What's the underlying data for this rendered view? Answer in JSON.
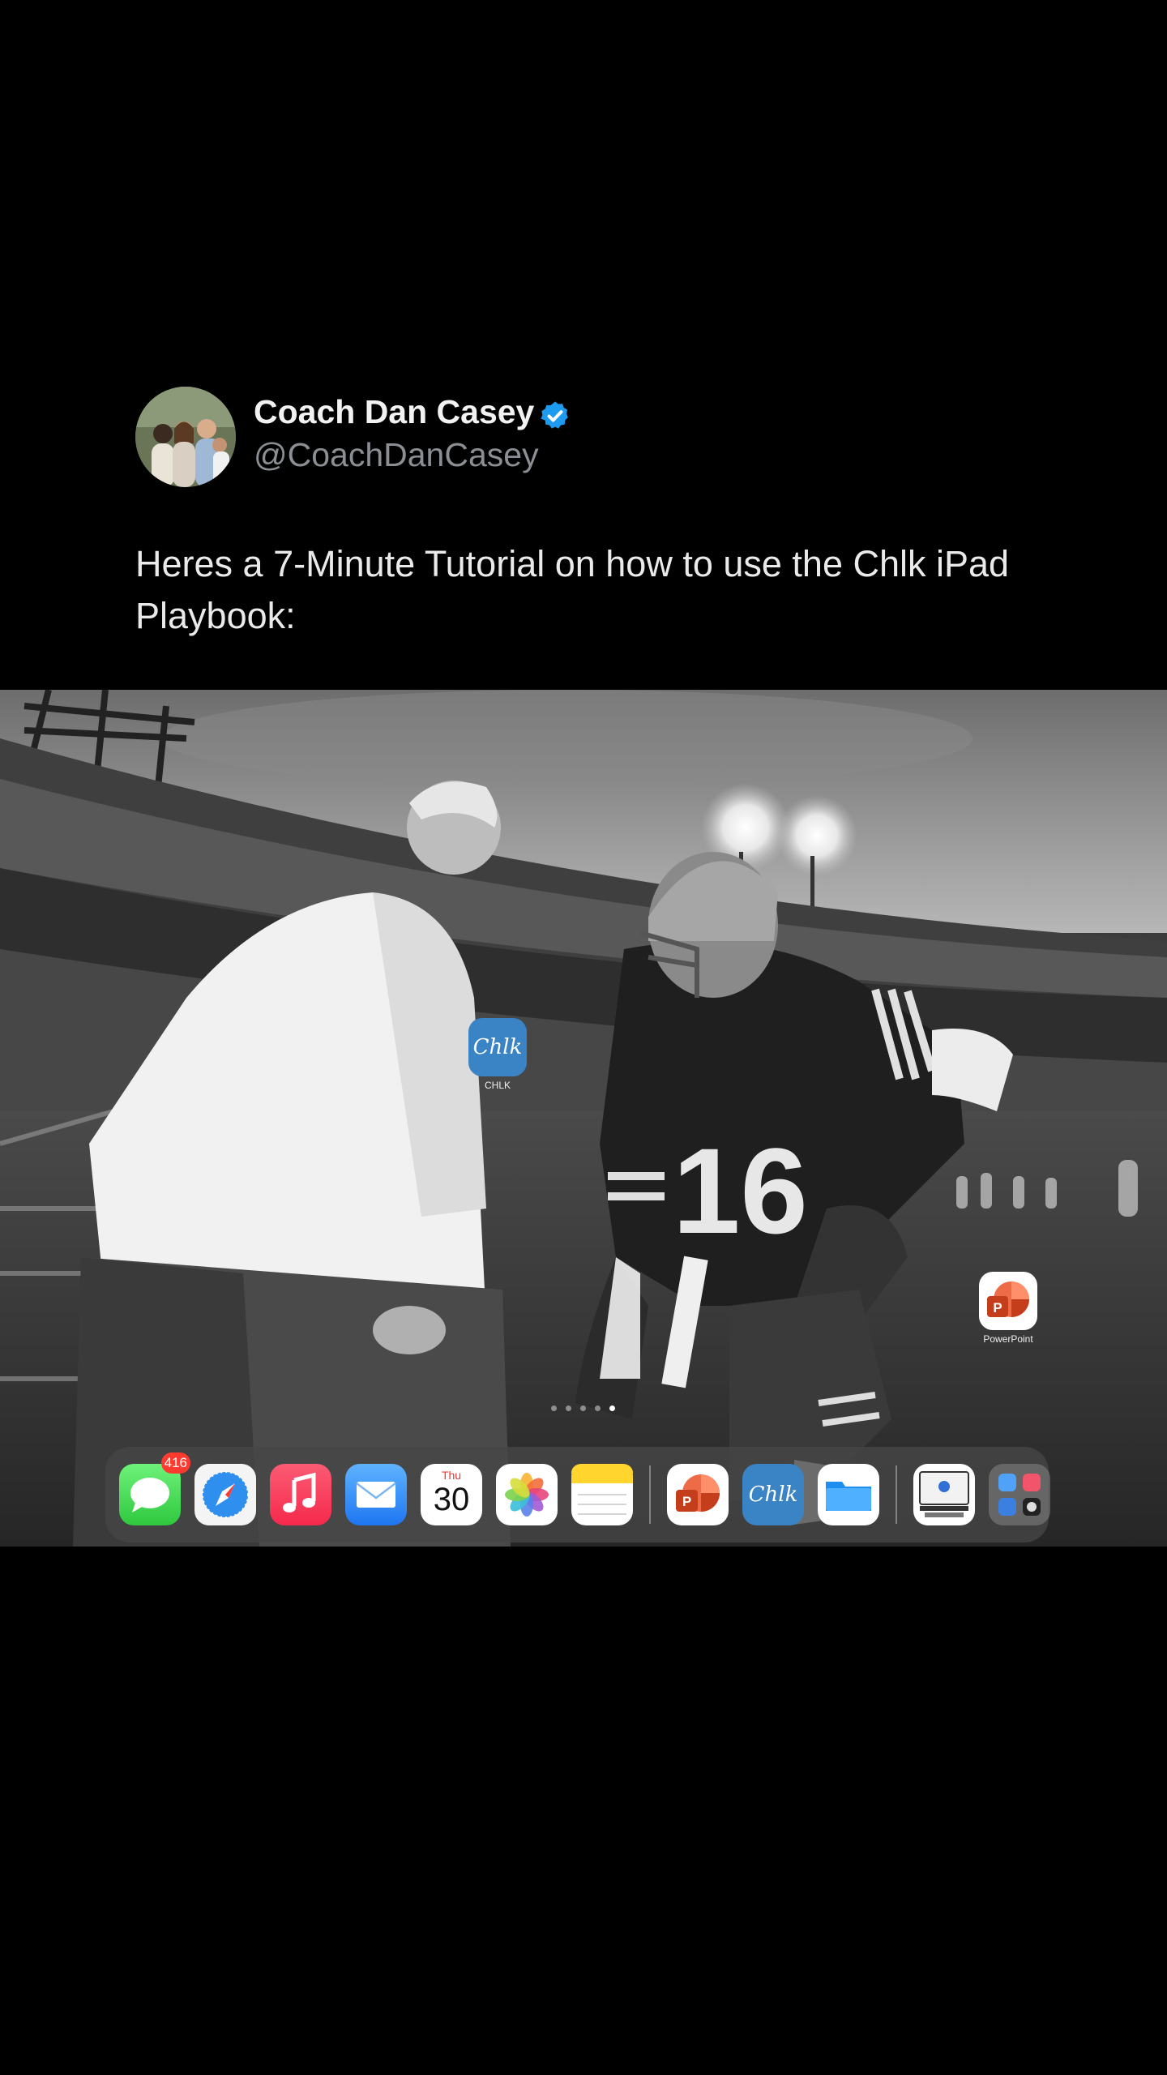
{
  "tweet": {
    "author_name": "Coach Dan Casey",
    "author_handle": "@CoachDanCasey",
    "verified": true,
    "text": "Heres a 7-Minute Tutorial on how to use the Chlk iPad Playbook:"
  },
  "media": {
    "jersey_number": "16",
    "home_icons": [
      {
        "name": "chlk-app",
        "label": "CHLK",
        "glyph": "Chlk"
      },
      {
        "name": "powerpoint-app",
        "label": "PowerPoint",
        "glyph": "P"
      }
    ],
    "page_dots": {
      "count": 5,
      "active_index": 4
    },
    "dock": {
      "apps": [
        {
          "name": "messages-app",
          "icon": "messages-icon",
          "badge": "416"
        },
        {
          "name": "safari-app",
          "icon": "compass-icon"
        },
        {
          "name": "music-app",
          "icon": "music-note-icon"
        },
        {
          "name": "mail-app",
          "icon": "envelope-icon"
        },
        {
          "name": "calendar-app",
          "icon": "calendar-icon",
          "day": "Thu",
          "date": "30"
        },
        {
          "name": "photos-app",
          "icon": "photos-flower-icon"
        },
        {
          "name": "notes-app",
          "icon": "notes-icon"
        }
      ],
      "recent_apps": [
        {
          "name": "powerpoint-app",
          "icon": "powerpoint-icon",
          "glyph": "P"
        },
        {
          "name": "chlk-app",
          "icon": "chlk-icon",
          "glyph": "Chlk"
        },
        {
          "name": "files-app",
          "icon": "folder-icon"
        }
      ],
      "extra_apps": [
        {
          "name": "document-scanner-app",
          "icon": "document-icon"
        },
        {
          "name": "app-library",
          "icon": "app-library-icon"
        }
      ]
    }
  },
  "colors": {
    "background": "#000000",
    "verified_badge": "#1d9bf0",
    "handle_text": "#8b8f94",
    "badge_red": "#ff3b30"
  }
}
